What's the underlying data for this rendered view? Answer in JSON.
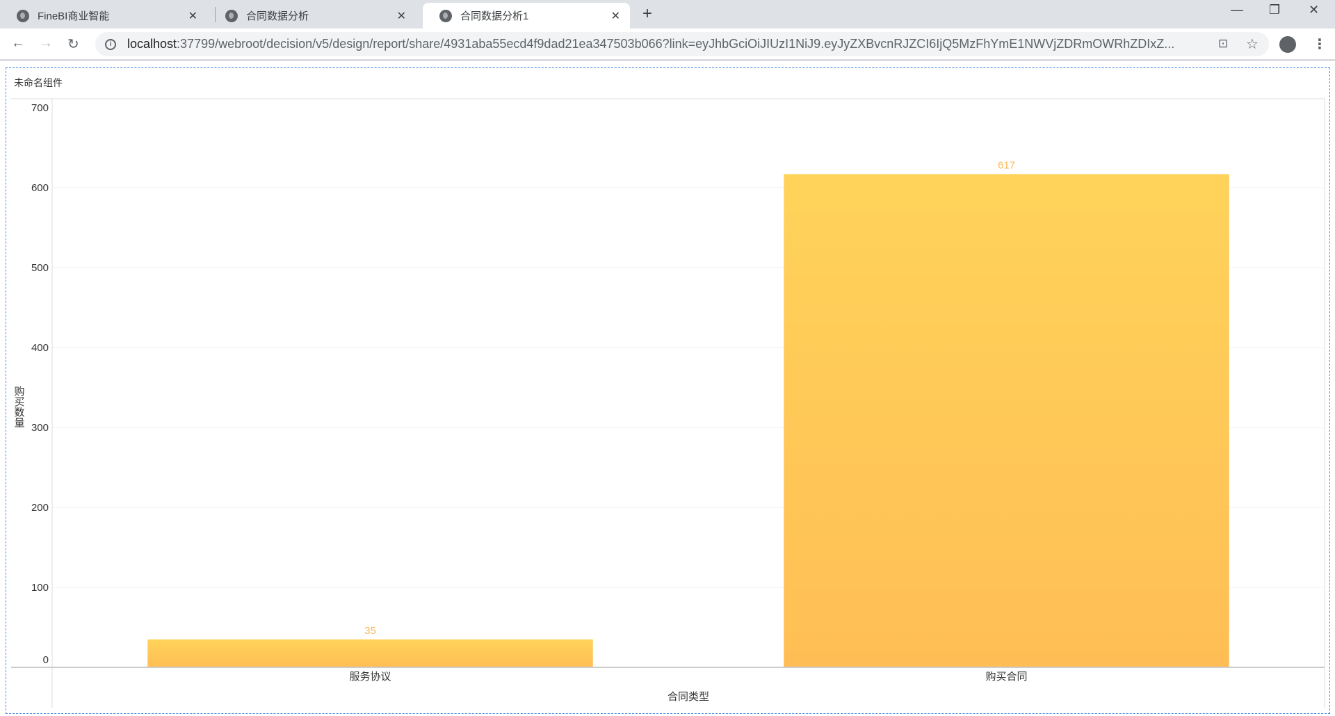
{
  "browser": {
    "tabs": [
      {
        "label": "FineBI商业智能"
      },
      {
        "label": "合同数据分析"
      },
      {
        "label": "合同数据分析1"
      }
    ],
    "url_host": "localhost",
    "url_rest": ":37799/webroot/decision/v5/design/report/share/4931aba55ecd4f9dad21ea347503b066?link=eyJhbGciOiJIUzI1NiJ9.eyJyZXBvcnRJZCI6IjQ5MzFhYmE1NWVjZDRmOWRhZDIxZ..."
  },
  "widget": {
    "title": "未命名组件"
  },
  "chart_data": {
    "type": "bar",
    "title": "未命名组件",
    "xlabel": "合同类型",
    "ylabel": "购买数量",
    "categories": [
      "服务协议",
      "购买合同"
    ],
    "values": [
      35,
      617
    ],
    "ylim": [
      0,
      700
    ],
    "yticks": [
      0,
      100,
      200,
      300,
      400,
      500,
      600,
      700
    ],
    "grid": true,
    "colors": {
      "bar_top": "#ffd35a",
      "bar_bottom": "#ffbe55",
      "label": "#f9b85a"
    }
  }
}
